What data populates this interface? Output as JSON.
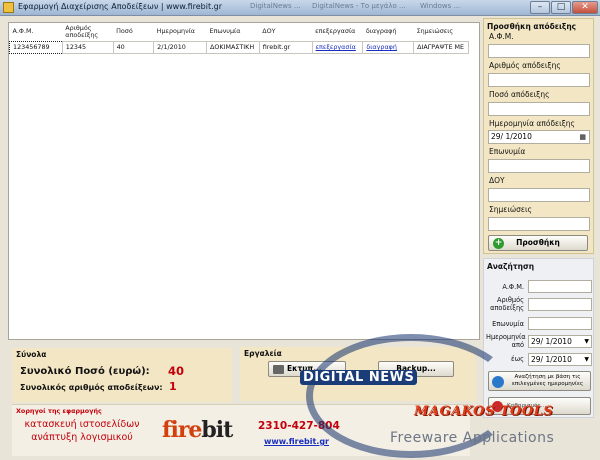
{
  "window": {
    "title": "Εφαρμογή Διαχείρισης Αποδείξεων | www.firebit.gr",
    "ghost_tabs": [
      "DigitalNews ...",
      "DigitalNews - Το μεγάλο ...",
      "Windows ..."
    ]
  },
  "grid": {
    "columns": [
      "Α.Φ.Μ.",
      "Αριθμός αποδείξης",
      "Ποσό",
      "Ημερομηνία",
      "Επωνυμία",
      "ΔΟΥ",
      "επεξεργασία",
      "διαγραφή",
      "Σημειώσεις"
    ],
    "rows": [
      {
        "afm": "123456789",
        "receipt_no": "12345",
        "amount": "40",
        "date": "2/1/2010",
        "name": "ΔΟΚΙΜΑΣΤΙΚΗ",
        "doy": "firebit.gr",
        "edit": "επεξεργασία",
        "delete": "διαγραφή",
        "notes": "ΔΙΑΓΡΑΨΤΕ ΜΕ"
      }
    ]
  },
  "add_panel": {
    "header": "Προσθήκη απόδειξης",
    "afm_label": "Α.Φ.Μ.",
    "receipt_label": "Αριθμός απόδειξης",
    "amount_label": "Ποσό απόδειξης",
    "date_label": "Ημερομηνία απόδειξης",
    "date_value": "29/  1/2010",
    "name_label": "Επωνυμία",
    "doy_label": "ΔΟΥ",
    "notes_label": "Σημειώσεις",
    "add_button": "Προσθήκη"
  },
  "search_panel": {
    "header": "Αναζήτηση",
    "afm_label": "Α.Φ.Μ.",
    "receipt_label": "Αριθμός αποδείξης",
    "name_label": "Επωνυμία",
    "from_label": "Ημερομηνία από",
    "from_value": "29/  1/2010",
    "to_label": "έως",
    "to_value": "29/  1/2010",
    "search_button": "Αναζήτηση με βάση τις επιλεγμένες ημερομηνίες",
    "clear_button": "Καθαρισμός..."
  },
  "totals": {
    "header": "Σύνολα",
    "total_amount_label": "Συνολικό Ποσό (ευρώ):",
    "total_amount_value": "40",
    "total_count_label": "Συνολικός αριθμός αποδείξεων:",
    "total_count_value": "1"
  },
  "tools": {
    "header": "Εργαλεία",
    "print_button": "Εκτυπ...",
    "backup_button": "Backup..."
  },
  "sponsor": {
    "header": "Χορηγοί της εφαρμογής",
    "slogan_line1": "κατασκευή ιστοσελίδων",
    "slogan_line2": "ανάπτυξη λογισμικού",
    "logo_fire": "fire",
    "logo_bit": "bit",
    "phone": "2310-427-804",
    "url": "www.firebit.gr"
  },
  "watermarks": {
    "digital": "DIGITAL NEWS",
    "magakos": "MAGAKOS TOOLS",
    "freeware": "Freeware Applications"
  },
  "colors": {
    "panel_bg": "#f2e6c4",
    "accent_red": "#c4000c",
    "link_blue": "#1a2fbf"
  }
}
